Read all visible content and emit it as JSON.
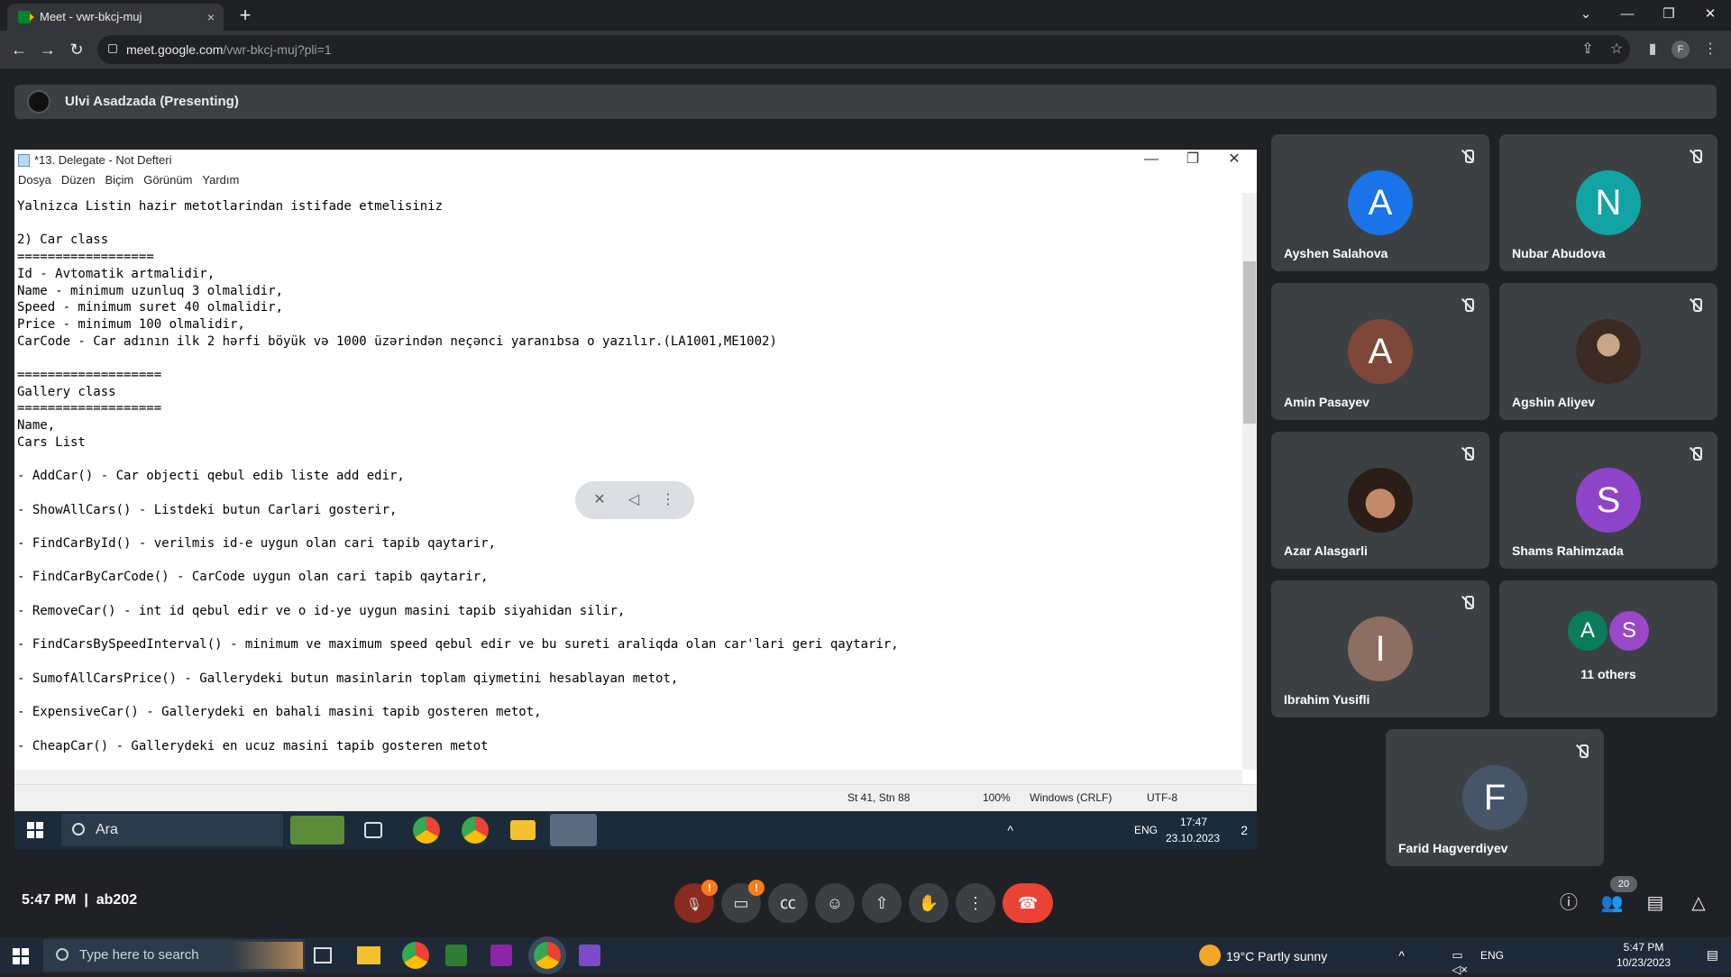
{
  "browser": {
    "tab_title": "Meet - vwr-bkcj-muj",
    "tab_close": "×",
    "new_tab": "+",
    "url_host": "meet.google.com",
    "url_path": "/vwr-bkcj-muj?pli=1",
    "profile_initial": "F",
    "window_controls": [
      "⌄",
      "—",
      "❐",
      "✕"
    ]
  },
  "presenter": {
    "label": "Ulvi Asadzada (Presenting)"
  },
  "notepad": {
    "title": "*13. Delegate - Not Defteri",
    "menu": [
      "Dosya",
      "Düzen",
      "Biçim",
      "Görünüm",
      "Yardım"
    ],
    "lines": [
      "Yalnizca Listin hazir metotlarindan istifade etmelisiniz",
      "",
      "2) Car class",
      "==================",
      "Id - Avtomatik artmalidir,",
      "Name - minimum uzunluq 3 olmalidir,",
      "Speed - minimum suret 40 olmalidir,",
      "Price - minimum 100 olmalidir,",
      "CarCode - Car adının ilk 2 hərfi böyük və 1000 üzərindən neçənci yaranıbsa o yazılır.(LA1001,ME1002)",
      "",
      "===================",
      "Gallery class",
      "===================",
      "Name,",
      "Cars List",
      "",
      "- AddCar() - Car objecti qebul edib liste add edir,",
      "",
      "- ShowAllCars() - Listdeki butun Carlari gosterir,",
      "",
      "- FindCarById() - verilmis id-e uygun olan cari tapib qaytarir,",
      "",
      "- FindCarByCarCode() - CarCode uygun olan cari tapib qaytarir,",
      "",
      "- RemoveCar() - int id qebul edir ve o id-ye uygun masini tapib siyahidan silir,",
      "",
      "- FindCarsBySpeedInterval() - minimum ve maximum speed qebul edir ve bu sureti araliqda olan car'lari geri qaytarir,",
      "",
      "- SumofAllCarsPrice() - Gallerydeki butun masinlarin toplam qiymetini hesablayan metot,",
      "",
      "- ExpensiveCar() - Gallerydeki en bahali masini tapib gosteren metot,",
      "",
      "- CheapCar() - Gallerydeki en ucuz masini tapib gosteren metot"
    ],
    "status_position": "St 41, Stn 88",
    "status_zoom": "100%",
    "status_eol": "Windows (CRLF)",
    "status_encoding": "UTF-8"
  },
  "inner_taskbar": {
    "search_placeholder": "Ara",
    "tray_lang": "ENG",
    "clock_time": "17:47",
    "clock_date": "23.10.2023",
    "notification_count": "2"
  },
  "participants": [
    {
      "name": "Ayshen Salahova",
      "initial": "A",
      "color": "#1a73e8"
    },
    {
      "name": "Nubar Abudova",
      "initial": "N",
      "color": "#12a4a4"
    },
    {
      "name": "Amin Pasayev",
      "initial": "A",
      "color": "#7d4739"
    },
    {
      "name": "Agshin Aliyev",
      "initial": "",
      "color": "#6d5a4a"
    },
    {
      "name": "Azar Alasgarli",
      "initial": "",
      "color": "#4b3a30"
    },
    {
      "name": "Shams Rahimzada",
      "initial": "S",
      "color": "#8e44c9"
    },
    {
      "name": "Ibrahim Yusifli",
      "initial": "I",
      "color": "#8d6e63"
    },
    {
      "name": "11 others",
      "initial": "",
      "color": ""
    },
    {
      "name": "Farid Hagverdiyev",
      "initial": "F",
      "color": "#475569"
    }
  ],
  "others_avatars": [
    {
      "initial": "A",
      "color": "#0b7c5a"
    },
    {
      "initial": "S",
      "color": "#9b47c9"
    }
  ],
  "meet": {
    "time": "5:47 PM",
    "meeting_code": "ab202",
    "people_count": "20",
    "alert_badge": "!"
  },
  "host_taskbar": {
    "search_placeholder": "Type here to search",
    "weather": "19°C  Partly sunny",
    "lang": "ENG",
    "clock_time": "5:47 PM",
    "clock_date": "10/23/2023"
  }
}
